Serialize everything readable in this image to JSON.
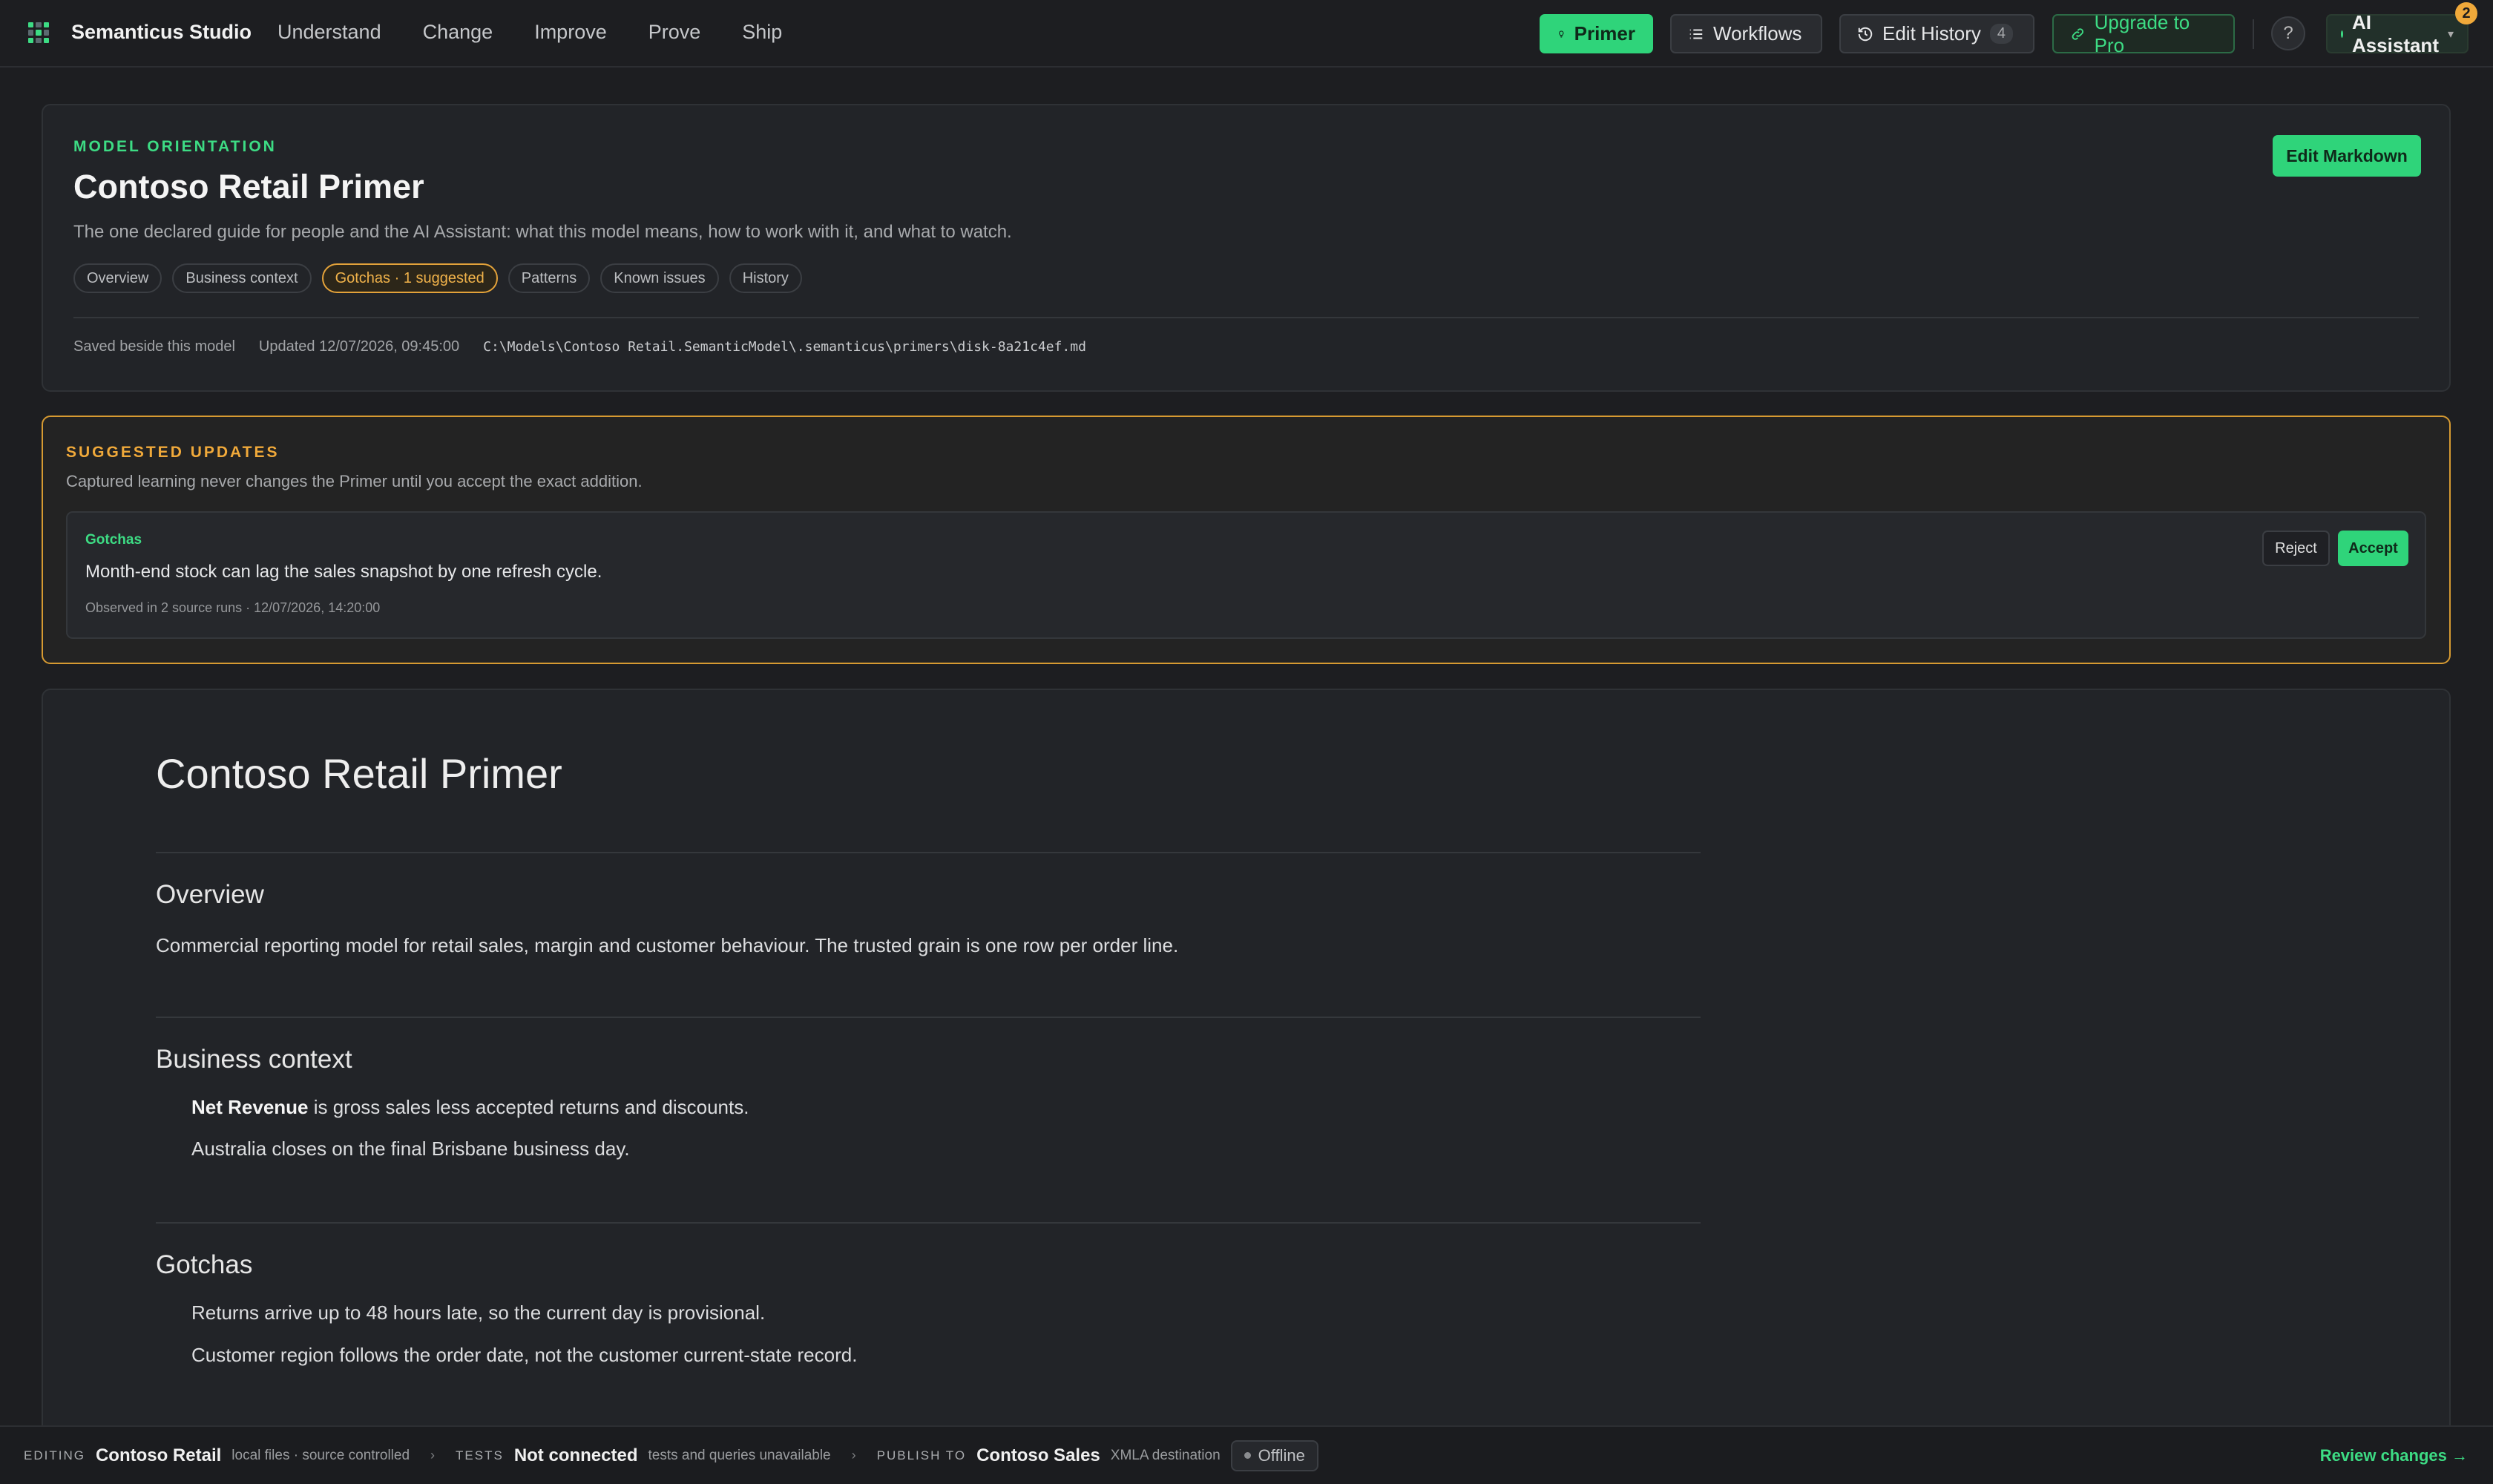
{
  "app": {
    "title": "Semanticus Studio"
  },
  "nav": [
    "Understand",
    "Change",
    "Improve",
    "Prove",
    "Ship"
  ],
  "toolbar": {
    "primer": "Primer",
    "workflows": "Workflows",
    "edit_history": "Edit History",
    "edit_history_count": "4",
    "upgrade": "Upgrade to Pro",
    "help": "?",
    "ai_assistant": "AI Assistant",
    "ai_badge": "2"
  },
  "primer": {
    "eyebrow": "MODEL ORIENTATION",
    "title": "Contoso Retail Primer",
    "description": "The one declared guide for people and the AI Assistant: what this model means, how to work with it, and what to watch.",
    "edit_button": "Edit Markdown",
    "chips": [
      "Overview",
      "Business context",
      "Gotchas · 1 suggested",
      "Patterns",
      "Known issues",
      "History"
    ],
    "saved": "Saved beside this model",
    "updated": "Updated 12/07/2026, 09:45:00",
    "path": "C:\\Models\\Contoso Retail.SemanticModel\\.semanticus\\primers\\disk-8a21c4ef.md"
  },
  "suggested": {
    "eyebrow": "SUGGESTED UPDATES",
    "description": "Captured learning never changes the Primer until you accept the exact addition.",
    "item": {
      "category": "Gotchas",
      "text": "Month-end stock can lag the sales snapshot by one refresh cycle.",
      "observed": "Observed in 2 source runs · 12/07/2026, 14:20:00",
      "reject": "Reject",
      "accept": "Accept"
    }
  },
  "markdown": {
    "title": "Contoso Retail Primer",
    "overview_h": "Overview",
    "overview_p": "Commercial reporting model for retail sales, margin and customer behaviour. The trusted grain is one row per order line.",
    "business_h": "Business context",
    "business_li1_b": "Net Revenue",
    "business_li1_rest": " is gross sales less accepted returns and discounts.",
    "business_li2": "Australia closes on the final Brisbane business day.",
    "gotchas_h": "Gotchas",
    "gotchas_li1": "Returns arrive up to 48 hours late, so the current day is provisional.",
    "gotchas_li2": "Customer region follows the order date, not the customer current-state record."
  },
  "status": {
    "editing_lbl": "EDITING",
    "editing_val": "Contoso Retail",
    "editing_sub": "local files · source controlled",
    "tests_lbl": "TESTS",
    "tests_val": "Not connected",
    "tests_sub": "tests and queries unavailable",
    "publish_lbl": "PUBLISH TO",
    "publish_val": "Contoso Sales",
    "publish_sub": "XMLA destination",
    "offline": "Offline",
    "review": "Review changes →"
  }
}
